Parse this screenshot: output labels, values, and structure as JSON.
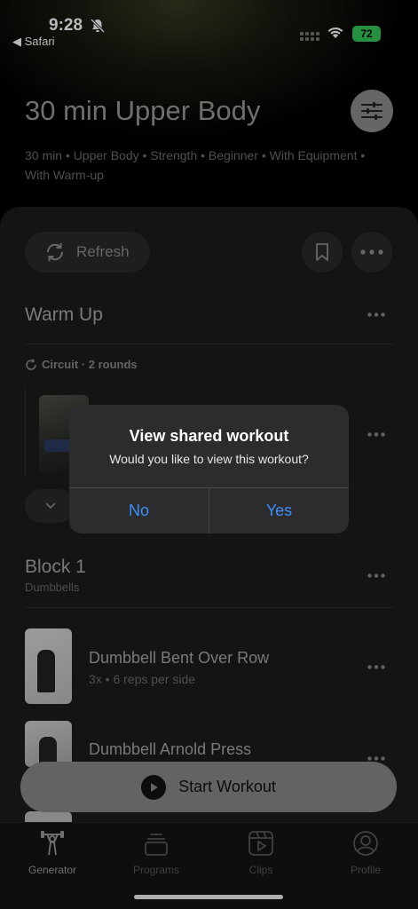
{
  "status_bar": {
    "time": "9:28",
    "back_app": "◀ Safari",
    "battery": "72"
  },
  "header": {
    "title": "30 min Upper Body",
    "tags": "30 min  •  Upper Body  •  Strength  •  Beginner  •  With Equipment  •  With Warm-up"
  },
  "actions": {
    "refresh_label": "Refresh"
  },
  "warm_up": {
    "title": "Warm Up",
    "circuit": "Circuit · 2 rounds"
  },
  "block1": {
    "title": "Block 1",
    "subtitle": "Dumbbells",
    "exercises": [
      {
        "name": "Dumbbell Bent Over Row",
        "detail": "3x • 6 reps per side"
      },
      {
        "name": "Dumbbell Arnold Press",
        "detail": ""
      }
    ]
  },
  "start_button": {
    "label": "Start Workout"
  },
  "tabs": [
    {
      "label": "Generator",
      "icon": "barbell-person-icon",
      "active": true
    },
    {
      "label": "Programs",
      "icon": "stack-icon",
      "active": false
    },
    {
      "label": "Clips",
      "icon": "play-clip-icon",
      "active": false
    },
    {
      "label": "Profile",
      "icon": "person-circle-icon",
      "active": false
    }
  ],
  "alert": {
    "title": "View shared workout",
    "message": "Would you like to view this workout?",
    "no_label": "No",
    "yes_label": "Yes"
  },
  "colors": {
    "accent_blue": "#3e8ef7",
    "battery_green": "#35c759",
    "card_bg": "#1c1c1e"
  }
}
